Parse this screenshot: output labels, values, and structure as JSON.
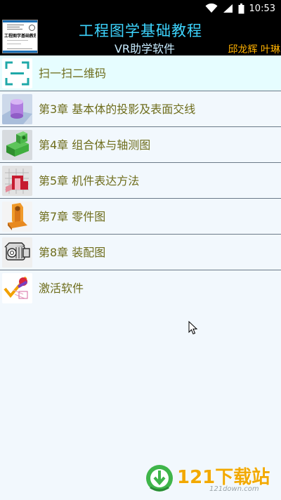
{
  "status_bar": {
    "time": "10:53",
    "icons": [
      "wifi-icon",
      "signal-icon",
      "battery-icon"
    ]
  },
  "header": {
    "title": "工程图学基础教程",
    "subtitle": "VR助学软件",
    "authors": "邱龙辉 叶琳",
    "cover_title": "工程图学基础教程",
    "colors": {
      "title": "#3dd5ff",
      "subtitle": "#c9ecff",
      "authors": "#ffb100",
      "background": "#000000"
    }
  },
  "menu": {
    "items": [
      {
        "label": "扫一扫二维码",
        "icon": "qr-scan-icon"
      },
      {
        "label": "第3章 基本体的投影及表面交线",
        "icon": "cylinder-icon"
      },
      {
        "label": "第4章 组合体与轴测图",
        "icon": "combined-solid-icon"
      },
      {
        "label": "第5章 机件表达方法",
        "icon": "section-view-icon"
      },
      {
        "label": "第7章 零件图",
        "icon": "part-icon"
      },
      {
        "label": "第8章 装配图",
        "icon": "assembly-icon"
      },
      {
        "label": "激活软件",
        "icon": "activate-key-icon"
      }
    ],
    "label_color": "#6e6d1c",
    "highlight_color": "#e6fdff"
  },
  "watermark": {
    "brand": "121下载站",
    "domain": "121down.com"
  }
}
